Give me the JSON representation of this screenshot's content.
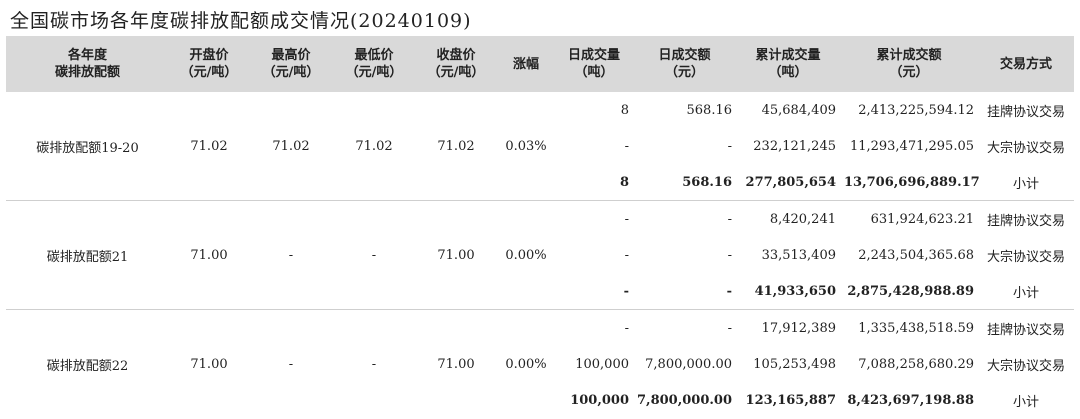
{
  "page": {
    "title": "全国碳市场各年度碳排放配额成交情况(20240109)"
  },
  "headers": [
    [
      "各年度",
      "碳排放配额"
    ],
    [
      "开盘价",
      "（元/吨）"
    ],
    [
      "最高价",
      "（元/吨）"
    ],
    [
      "最低价",
      "（元/吨）"
    ],
    [
      "收盘价",
      "（元/吨）"
    ],
    [
      "涨幅"
    ],
    [
      "日成交量",
      "（吨）"
    ],
    [
      "日成交额",
      "（元）"
    ],
    [
      "累计成交量",
      "（吨）"
    ],
    [
      "累计成交额",
      "（元）"
    ],
    [
      "交易方式"
    ]
  ],
  "groups": [
    {
      "name": "碳排放配额19-20",
      "open": "71.02",
      "high": "71.02",
      "low": "71.02",
      "close": "71.02",
      "change": "0.03%",
      "rows": [
        {
          "daily_volume": "8",
          "daily_amount": "568.16",
          "cum_volume": "45,684,409",
          "cum_amount": "2,413,225,594.12",
          "method": "挂牌协议交易"
        },
        {
          "daily_volume": "-",
          "daily_amount": "-",
          "cum_volume": "232,121,245",
          "cum_amount": "11,293,471,295.05",
          "method": "大宗协议交易"
        },
        {
          "daily_volume": "8",
          "daily_amount": "568.16",
          "cum_volume": "277,805,654",
          "cum_amount": "13,706,696,889.17",
          "method": "小计"
        }
      ]
    },
    {
      "name": "碳排放配额21",
      "open": "71.00",
      "high": "-",
      "low": "-",
      "close": "71.00",
      "change": "0.00%",
      "rows": [
        {
          "daily_volume": "-",
          "daily_amount": "-",
          "cum_volume": "8,420,241",
          "cum_amount": "631,924,623.21",
          "method": "挂牌协议交易"
        },
        {
          "daily_volume": "-",
          "daily_amount": "-",
          "cum_volume": "33,513,409",
          "cum_amount": "2,243,504,365.68",
          "method": "大宗协议交易"
        },
        {
          "daily_volume": "-",
          "daily_amount": "-",
          "cum_volume": "41,933,650",
          "cum_amount": "2,875,428,988.89",
          "method": "小计"
        }
      ]
    },
    {
      "name": "碳排放配额22",
      "open": "71.00",
      "high": "-",
      "low": "-",
      "close": "71.00",
      "change": "0.00%",
      "rows": [
        {
          "daily_volume": "-",
          "daily_amount": "-",
          "cum_volume": "17,912,389",
          "cum_amount": "1,335,438,518.59",
          "method": "挂牌协议交易"
        },
        {
          "daily_volume": "100,000",
          "daily_amount": "7,800,000.00",
          "cum_volume": "105,253,498",
          "cum_amount": "7,088,258,680.29",
          "method": "大宗协议交易"
        },
        {
          "daily_volume": "100,000",
          "daily_amount": "7,800,000.00",
          "cum_volume": "123,165,887",
          "cum_amount": "8,423,697,198.88",
          "method": "小计"
        }
      ]
    }
  ]
}
